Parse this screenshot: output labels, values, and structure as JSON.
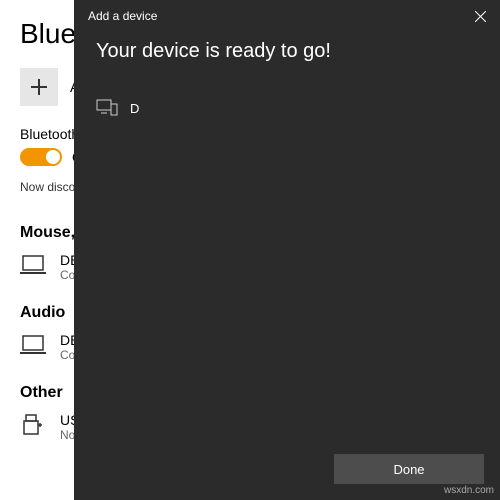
{
  "settings": {
    "title": "Bluetooth",
    "addLabel": "Add",
    "btLabel": "Bluetooth",
    "toggleState": "On",
    "discoverText": "Now discoverable",
    "sections": {
      "mouse": {
        "head": "Mouse,",
        "devName": "DE",
        "devStatus": "Co"
      },
      "audio": {
        "head": "Audio",
        "devName": "DE",
        "devStatus": "Co"
      },
      "other": {
        "head": "Other",
        "devName": "US",
        "devStatus": "No"
      }
    }
  },
  "modal": {
    "title": "Add a device",
    "readyMsg": "Your device is ready to go!",
    "pairedName": "D",
    "doneLabel": "Done"
  },
  "watermark": "wsxdn.com"
}
